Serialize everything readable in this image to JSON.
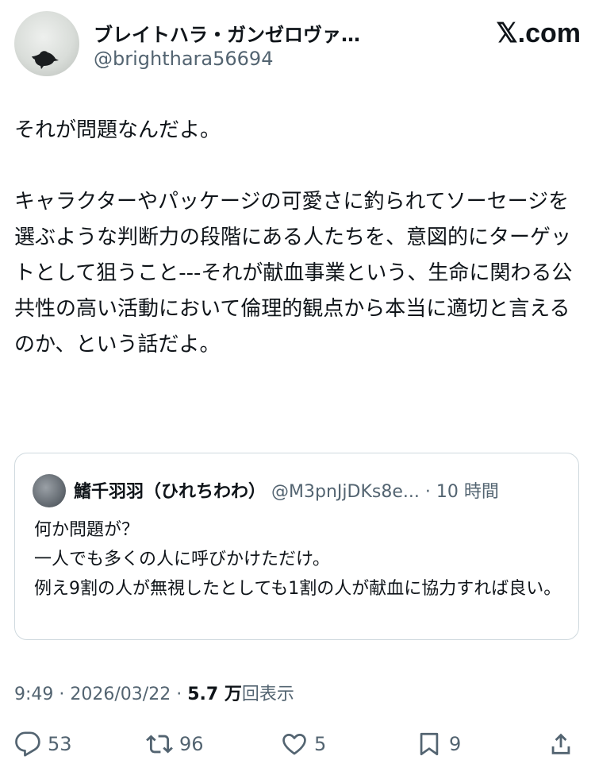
{
  "author": {
    "display_name": "ブレイトハラ・ガンゼロヴァ…",
    "handle": "@brighthara56694",
    "avatar": "bird-silhouette-avatar"
  },
  "brand": "𝕏.com",
  "post": {
    "text": "それが問題なんだよ。\n\nキャラクターやパッケージの可愛さに釣られてソーセージを選ぶような判断力の段階にある人たちを、意図的にターゲットとして狙うこと---それが献血事業という、生命に関わる公共性の高い活動において倫理的観点から本当に適切と言えるのか、という話だよ。"
  },
  "quoted_post": {
    "display_name": "鰭千羽羽（ひれちわわ）",
    "handle": "@M3pnJjDKs8e...",
    "separator": " · ",
    "time": "10 時間",
    "text": "何か問題が？\n一人でも多くの人に呼びかけただけ。\n例え9割の人が無視したとしても1割の人が献血に協力すれば良い。"
  },
  "meta": {
    "time": "9:49",
    "separator": " · ",
    "date": "2026/03/22",
    "separator2": " · ",
    "views_count": "5.7 万",
    "views_label": "回表示"
  },
  "actions": {
    "replies": "53",
    "reposts": "96",
    "likes": "5",
    "bookmarks": "9"
  },
  "icons": [
    "reply-icon",
    "repost-icon",
    "like-icon",
    "bookmark-icon",
    "share-icon"
  ],
  "colors": {
    "text": "#0f1419",
    "secondary": "#536471",
    "border": "#cfd9de"
  }
}
